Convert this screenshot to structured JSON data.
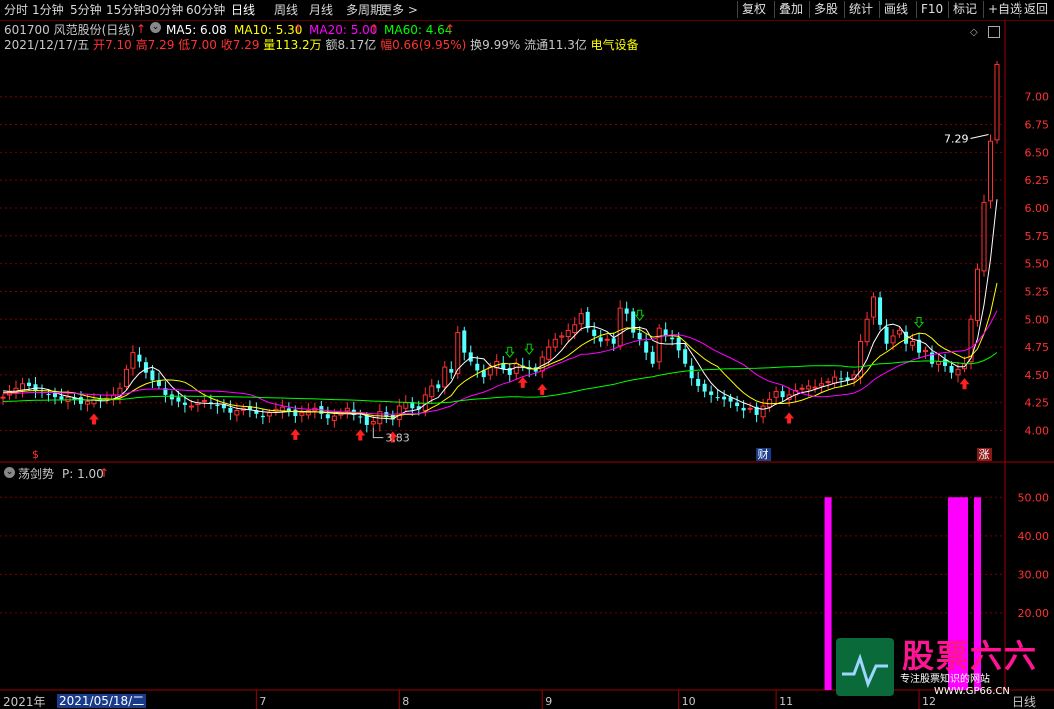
{
  "toolbar": {
    "tabs": [
      "分时",
      "1分钟",
      "5分钟",
      "15分钟",
      "30分钟",
      "60分钟",
      "日线",
      "周线",
      "月线",
      "多周期",
      "更多 >"
    ],
    "active_tab": "日线",
    "right_buttons": [
      "复权",
      "叠加",
      "多股",
      "统计",
      "画线",
      "F10",
      "标记",
      "+自选",
      "返回"
    ]
  },
  "header": {
    "stock": "601700 风范股份(日线)",
    "ma5": "MA5: 6.08",
    "ma10": "MA10: 5.30",
    "ma20": "MA20: 5.00",
    "ma60": "MA60: 4.64"
  },
  "quote": {
    "date": "2021/12/17/五",
    "open_label": "开",
    "open": "7.10",
    "high_label": "高",
    "high": "7.29",
    "low_label": "低",
    "low": "7.00",
    "close_label": "收",
    "close": "7.29",
    "vol_label": "量",
    "vol": "113.2万",
    "amt_label": "额",
    "amt": "8.17亿",
    "chg_label": "幅",
    "chg": "0.66(9.95%)",
    "turnover_label": "换",
    "turnover": "9.99%",
    "float_label": "流通",
    "float": "11.3亿",
    "sector": "电气设备"
  },
  "indicator": {
    "name": "荡剑势",
    "param": "P: 1.00"
  },
  "footer": {
    "year": "2021年",
    "cursor_date": "2021/05/18/二"
  },
  "watermark": {
    "brand": "股票六六",
    "tagline": "专注股票知识的网站",
    "url": "WWW.GP66.CN"
  },
  "colors": {
    "up": "#ff3232",
    "down": "#54ffff",
    "ma5": "#ffffff",
    "ma10": "#ffff00",
    "ma20": "#ff00ff",
    "ma60": "#00ff00",
    "grid": "#7a0000",
    "histogram": "#ff00ff"
  },
  "chart_data": {
    "type": "candlestick",
    "price_axis": {
      "ticks": [
        4.0,
        4.25,
        4.5,
        4.75,
        5.0,
        5.25,
        5.5,
        5.75,
        6.0,
        6.25,
        6.5,
        6.75,
        7.0
      ],
      "ylim": [
        3.78,
        7.42
      ]
    },
    "month_labels": [
      {
        "label": "7",
        "index": 39
      },
      {
        "label": "8",
        "index": 61
      },
      {
        "label": "9",
        "index": 83
      },
      {
        "label": "10",
        "index": 104
      },
      {
        "label": "11",
        "index": 119
      },
      {
        "label": "12",
        "index": 141
      }
    ],
    "annotations": {
      "high_label": "7.29",
      "high_index": 152,
      "low_label": "3.83",
      "low_index": 57,
      "event_markers": [
        {
          "index": 5,
          "label": "$"
        },
        {
          "index": 117,
          "label": "财"
        },
        {
          "index": 151,
          "label": "涨"
        }
      ]
    },
    "buy_arrows": [
      14,
      45,
      55,
      60,
      80,
      83,
      121,
      148
    ],
    "sell_arrows": [
      78,
      81,
      98,
      141
    ],
    "closes": [
      4.3,
      4.35,
      4.38,
      4.42,
      4.4,
      4.36,
      4.34,
      4.32,
      4.3,
      4.28,
      4.3,
      4.28,
      4.24,
      4.26,
      4.28,
      4.27,
      4.29,
      4.32,
      4.38,
      4.55,
      4.7,
      4.62,
      4.52,
      4.45,
      4.4,
      4.32,
      4.28,
      4.26,
      4.23,
      4.22,
      4.25,
      4.27,
      4.24,
      4.22,
      4.2,
      4.16,
      4.18,
      4.2,
      4.19,
      4.15,
      4.12,
      4.16,
      4.19,
      4.21,
      4.17,
      4.13,
      4.16,
      4.18,
      4.2,
      4.15,
      4.11,
      4.13,
      4.16,
      4.2,
      4.14,
      4.12,
      4.05,
      4.08,
      4.17,
      4.12,
      4.1,
      4.22,
      4.25,
      4.2,
      4.19,
      4.32,
      4.4,
      4.38,
      4.57,
      4.52,
      4.88,
      4.7,
      4.62,
      4.54,
      4.48,
      4.57,
      4.62,
      4.55,
      4.5,
      4.6,
      4.58,
      4.55,
      4.53,
      4.66,
      4.75,
      4.82,
      4.85,
      4.9,
      4.95,
      5.05,
      4.92,
      4.85,
      4.8,
      4.82,
      4.78,
      5.1,
      5.05,
      4.88,
      4.82,
      4.7,
      4.6,
      4.92,
      4.85,
      4.82,
      4.72,
      4.6,
      4.47,
      4.4,
      4.35,
      4.32,
      4.3,
      4.28,
      4.26,
      4.22,
      4.18,
      4.2,
      4.14,
      4.22,
      4.28,
      4.35,
      4.3,
      4.32,
      4.36,
      4.38,
      4.4,
      4.39,
      4.42,
      4.44,
      4.48,
      4.46,
      4.45,
      4.5,
      4.8,
      5.0,
      5.2,
      4.95,
      4.78,
      4.85,
      4.9,
      4.78,
      4.8,
      4.7,
      4.72,
      4.6,
      4.62,
      4.58,
      4.52,
      4.55,
      4.6,
      5.0,
      5.45,
      6.05,
      6.6,
      7.29
    ],
    "histogram": {
      "ticks": [
        20.0,
        30.0,
        40.0,
        50.0
      ],
      "ylim": [
        0,
        55
      ],
      "bars": [
        {
          "index": 127,
          "value": 50
        },
        {
          "index": 146,
          "value": 50
        },
        {
          "index": 147,
          "value": 50
        },
        {
          "index": 148,
          "value": 50
        },
        {
          "index": 150,
          "value": 50
        }
      ]
    }
  }
}
